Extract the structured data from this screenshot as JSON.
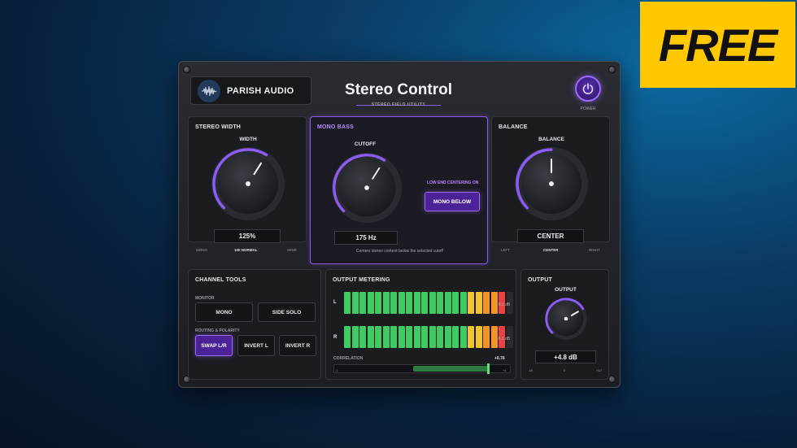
{
  "badge": {
    "label": "FREE"
  },
  "header": {
    "brand": "PARISH AUDIO",
    "title": "Stereo Control",
    "subtitle": "STEREO FIELD UTILITY",
    "power_label": "POWER"
  },
  "stereo_width": {
    "title": "STEREO WIDTH",
    "knob_label": "WIDTH",
    "value": "125%",
    "knob_level": 0.62,
    "scale": {
      "left": "MONO",
      "center": "100 NORMAL",
      "right": "WIDE"
    }
  },
  "mono_bass": {
    "title": "MONO BASS",
    "knob_label": "CUTOFF",
    "value": "175 Hz",
    "knob_level": 0.62,
    "status": "LOW END CENTERING ON",
    "button": "MONO BELOW",
    "description": "Centers stereo content below the selected cutoff"
  },
  "balance": {
    "title": "BALANCE",
    "knob_label": "BALANCE",
    "value": "CENTER",
    "knob_level": 0.5,
    "scale": {
      "left": "LEFT",
      "center": "CENTER",
      "right": "RIGHT"
    }
  },
  "channel_tools": {
    "title": "CHANNEL TOOLS",
    "monitor_label": "MONITOR",
    "mono": "MONO",
    "side_solo": "SIDE SOLO",
    "routing_label": "ROUTING & POLARITY",
    "swap": "SWAP L/R",
    "invert_l": "INVERT L",
    "invert_r": "INVERT R"
  },
  "metering": {
    "title": "OUTPUT METERING",
    "left": {
      "label": "L",
      "db": "-5.1 dB",
      "segments": [
        "g",
        "g",
        "g",
        "g",
        "g",
        "g",
        "g",
        "g",
        "g",
        "g",
        "g",
        "g",
        "g",
        "g",
        "g",
        "g",
        "y",
        "y",
        "o",
        "o",
        "r",
        "off"
      ]
    },
    "right": {
      "label": "R",
      "db": "-5.1 dB",
      "segments": [
        "g",
        "g",
        "g",
        "g",
        "g",
        "g",
        "g",
        "g",
        "g",
        "g",
        "g",
        "g",
        "g",
        "g",
        "g",
        "g",
        "y",
        "y",
        "o",
        "o",
        "r",
        "off"
      ]
    },
    "correlation_label": "CORRELATION",
    "correlation_value": "+0.76",
    "correlation": 0.76,
    "corr_min": "-1",
    "corr_max": "+1"
  },
  "output": {
    "title": "OUTPUT",
    "knob_label": "OUTPUT",
    "value": "+4.8 dB",
    "knob_level": 0.72,
    "scale": {
      "left": "-18",
      "center": "0",
      "right": "+12"
    }
  },
  "colors": {
    "accent": "#8b5cf6",
    "badge": "#ffc800"
  }
}
